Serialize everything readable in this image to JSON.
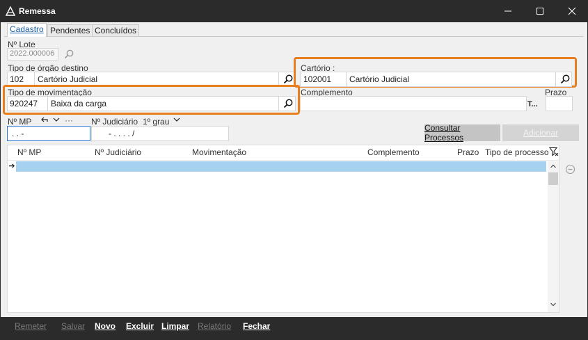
{
  "window": {
    "title": "Remessa",
    "app_icon": "app-logo-icon",
    "minimize_icon": "minimize-icon",
    "maximize_icon": "maximize-icon",
    "close_icon": "close-icon"
  },
  "tabs": [
    {
      "label": "Cadastro",
      "active": true
    },
    {
      "label": "Pendentes",
      "active": false
    },
    {
      "label": "Concluídos",
      "active": false
    }
  ],
  "form": {
    "lote_label": "Nº Lote",
    "lote_value": "2022.000006",
    "orgao_label": "Tipo de órgão destino",
    "orgao_code": "102",
    "orgao_name": "Cartório Judicial",
    "cartorio_label": "Cartório :",
    "cartorio_code": "102001",
    "cartorio_name": "Cartório Judicial",
    "movimentacao_label": "Tipo de movimentação",
    "movimentacao_code": "920247",
    "movimentacao_name": "Baixa da carga",
    "complemento_label": "Complemento",
    "complemento_value": "",
    "complemento_suffix": "T...",
    "prazo_label": "Prazo",
    "prazo_value": "",
    "mp_label": "Nº MP",
    "mp_value": ".   .      -",
    "mp_more": "···",
    "judiciario_label": "Nº Judiciário",
    "grau_label": "1º grau",
    "judiciario_value": "-  .    .  .  .    /"
  },
  "buttons": {
    "consultar": "Consultar Processos",
    "adicionar": "Adicionar"
  },
  "grid": {
    "columns": [
      "Nº MP",
      "Nº Judiciário",
      "Movimentação",
      "Complemento",
      "Prazo",
      "Tipo de processo"
    ],
    "row_indicator": "➔"
  },
  "colors": {
    "highlight": "#e87e1e",
    "selected_row": "#a6d2f0",
    "active_tab_text": "#1a5ea8"
  },
  "bottom_bar": [
    {
      "label": "Remeter",
      "enabled": false
    },
    {
      "label": "Salvar",
      "enabled": false
    },
    {
      "label": "Novo",
      "enabled": true
    },
    {
      "label": "Excluir",
      "enabled": true
    },
    {
      "label": "Limpar",
      "enabled": true
    },
    {
      "label": "Relatório",
      "enabled": false
    },
    {
      "label": "Fechar",
      "enabled": true
    }
  ]
}
